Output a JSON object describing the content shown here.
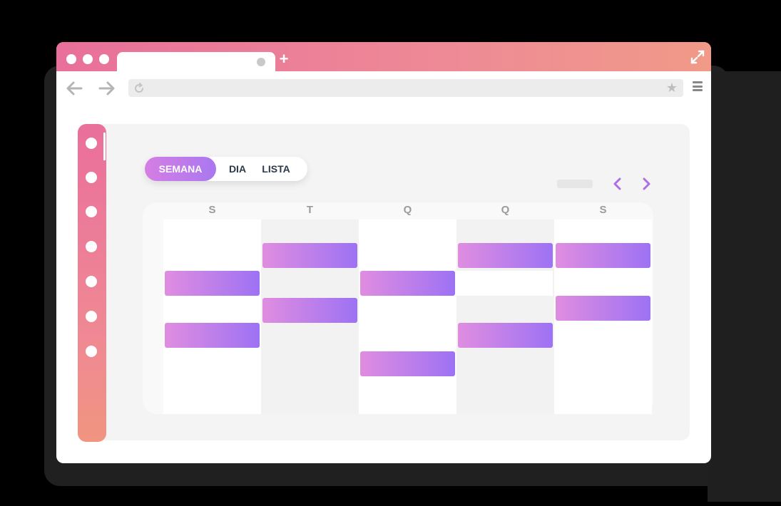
{
  "colors": {
    "accent_start": "#e08de0",
    "accent_end": "#9d72f4",
    "titlebar_start": "#e8709a",
    "titlebar_end": "#f19a88"
  },
  "icons": {
    "back": "arrow-left-icon",
    "forward": "arrow-right-icon",
    "reload": "reload-icon",
    "bookmark": "star-icon",
    "menu": "hamburger-menu-icon",
    "expand": "expand-icon",
    "new_tab": "plus-icon"
  },
  "browser": {
    "new_tab_symbol": "+",
    "bookmark_symbol": "★"
  },
  "calendar": {
    "views": [
      "SEMANA",
      "DIA",
      "LISTA"
    ],
    "active_view": "SEMANA",
    "days": [
      "S",
      "T",
      "Q",
      "Q",
      "S"
    ]
  }
}
